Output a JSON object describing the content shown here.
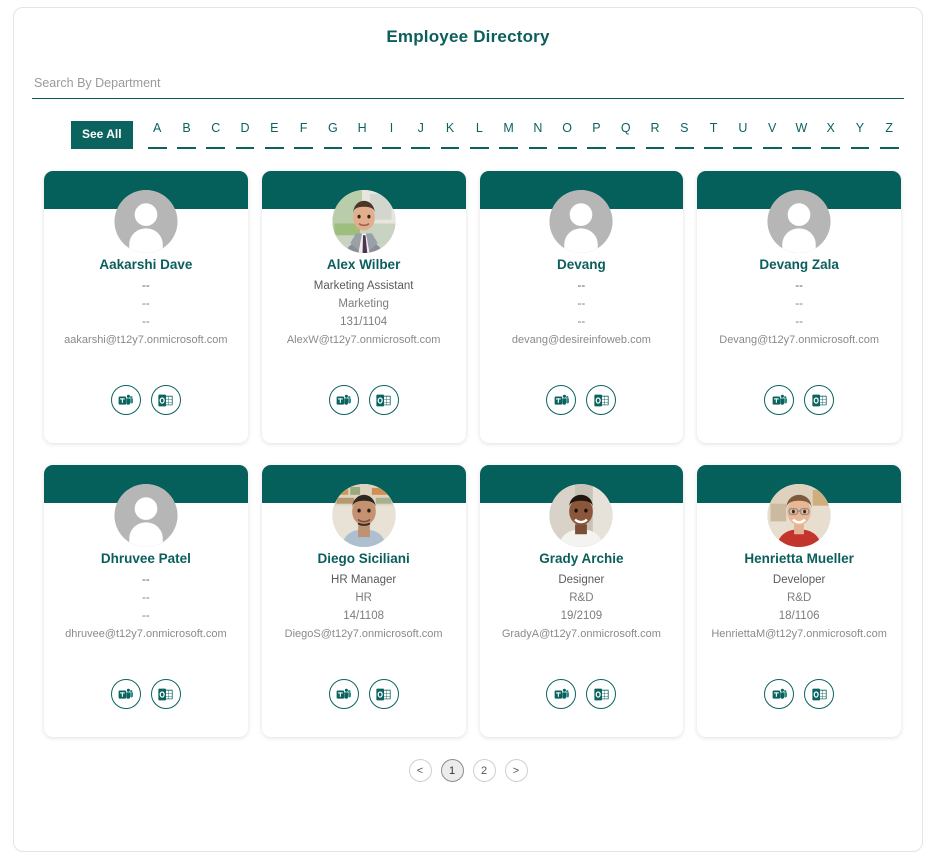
{
  "header": {
    "title": "Employee Directory"
  },
  "search": {
    "placeholder": "Search By Department",
    "value": ""
  },
  "alpha_filter": {
    "see_all_label": "See All",
    "active": "See All",
    "letters": [
      "A",
      "B",
      "C",
      "D",
      "E",
      "F",
      "G",
      "H",
      "I",
      "J",
      "K",
      "L",
      "M",
      "N",
      "O",
      "P",
      "Q",
      "R",
      "S",
      "T",
      "U",
      "V",
      "W",
      "X",
      "Y",
      "Z"
    ]
  },
  "actions": {
    "teams_icon": "microsoft-teams-icon",
    "outlook_icon": "microsoft-outlook-icon",
    "teams_label": "Chat on Teams",
    "outlook_label": "Send email in Outlook"
  },
  "employees": [
    {
      "name": "Aakarshi Dave",
      "job_title": "--",
      "department": "--",
      "office": "--",
      "email": "aakarshi@t12y7.onmicrosoft.com",
      "avatar": "placeholder"
    },
    {
      "name": "Alex Wilber",
      "job_title": "Marketing Assistant",
      "department": "Marketing",
      "office": "131/1104",
      "email": "AlexW@t12y7.onmicrosoft.com",
      "avatar": "photo-alex"
    },
    {
      "name": "Devang",
      "job_title": "--",
      "department": "--",
      "office": "--",
      "email": "devang@desireinfoweb.com",
      "avatar": "placeholder"
    },
    {
      "name": "Devang Zala",
      "job_title": "--",
      "department": "--",
      "office": "--",
      "email": "Devang@t12y7.onmicrosoft.com",
      "avatar": "placeholder"
    },
    {
      "name": "Dhruvee Patel",
      "job_title": "--",
      "department": "--",
      "office": "--",
      "email": "dhruvee@t12y7.onmicrosoft.com",
      "avatar": "placeholder"
    },
    {
      "name": "Diego Siciliani",
      "job_title": "HR Manager",
      "department": "HR",
      "office": "14/1108",
      "email": "DiegoS@t12y7.onmicrosoft.com",
      "avatar": "photo-diego"
    },
    {
      "name": "Grady Archie",
      "job_title": "Designer",
      "department": "R&D",
      "office": "19/2109",
      "email": "GradyA@t12y7.onmicrosoft.com",
      "avatar": "photo-grady"
    },
    {
      "name": "Henrietta Mueller",
      "job_title": "Developer",
      "department": "R&D",
      "office": "18/1106",
      "email": "HenriettaM@t12y7.onmicrosoft.com",
      "avatar": "photo-henrietta"
    }
  ],
  "pagination": {
    "prev_label": "<",
    "next_label": ">",
    "pages": [
      "1",
      "2"
    ],
    "current_page": "1"
  },
  "colors": {
    "brand_teal": "#055f5a",
    "name_teal": "#0b5e5c",
    "accent": "#0b6360",
    "muted_text": "#7d7d7d"
  }
}
